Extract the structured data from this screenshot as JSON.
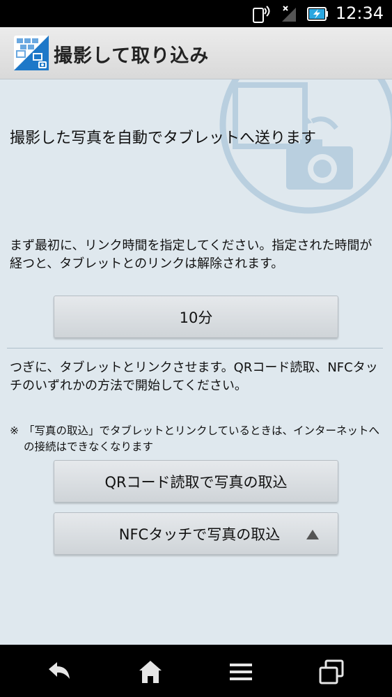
{
  "status_bar": {
    "time": "12:34"
  },
  "action_bar": {
    "title": "撮影して取り込み"
  },
  "main": {
    "headline": "撮影した写真を自動でタブレットへ送ります",
    "instruction1": "まず最初に、リンク時間を指定してください。指定された時間が経つと、タブレットとのリンクは解除されます。",
    "link_time_value": "10分",
    "instruction2": "つぎに、タブレットとリンクさせます。QRコード読取、NFCタッチのいずれかの方法で開始してください。",
    "note_mark": "※",
    "note": "「写真の取込」でタブレットとリンクしているときは、インターネットへの接続はできなくなります",
    "qr_button": "QRコード読取で写真の取込",
    "nfc_button": "NFCタッチで写真の取込"
  },
  "colors": {
    "background": "#dfe8ee",
    "accent": "#1e78c8",
    "watermark": "#b9cfdf"
  },
  "icons": [
    "nfc-icon",
    "signal-icon",
    "battery-charging-icon",
    "app-icon",
    "camera-watermark-icon",
    "triangle-up-icon",
    "back-icon",
    "home-icon",
    "menu-icon",
    "recent-apps-icon"
  ]
}
